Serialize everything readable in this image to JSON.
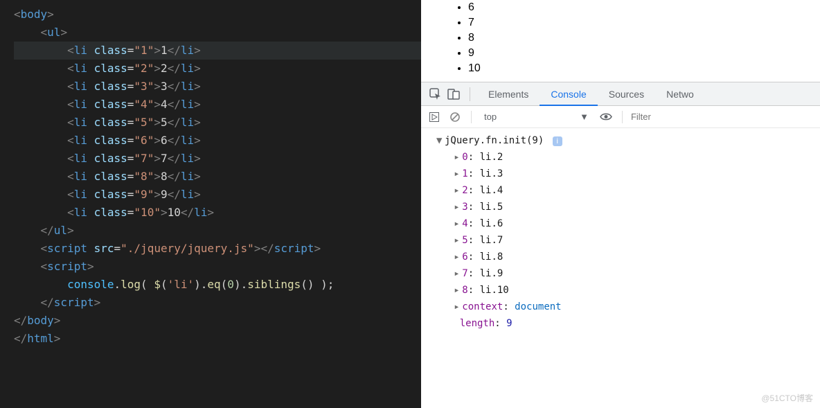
{
  "editor": {
    "lines": [
      {
        "indent": 0,
        "tokens": [
          [
            "punct",
            "<"
          ],
          [
            "tag",
            "body"
          ],
          [
            "punct",
            ">"
          ]
        ]
      },
      {
        "indent": 1,
        "tokens": [
          [
            "punct",
            "<"
          ],
          [
            "tag",
            "ul"
          ],
          [
            "punct",
            ">"
          ]
        ]
      },
      {
        "indent": 2,
        "highlighted": true,
        "tokens": [
          [
            "punct",
            "<"
          ],
          [
            "tag",
            "li"
          ],
          [
            "txt",
            " "
          ],
          [
            "attr",
            "class"
          ],
          [
            "op",
            "="
          ],
          [
            "str",
            "\"1\""
          ],
          [
            "punct",
            ">"
          ],
          [
            "txt",
            "1"
          ],
          [
            "punct",
            "<"
          ],
          [
            "punct",
            "/"
          ],
          [
            "tag",
            "li"
          ],
          [
            "punct",
            ">"
          ]
        ],
        "caret_after": 8
      },
      {
        "indent": 2,
        "tokens": [
          [
            "punct",
            "<"
          ],
          [
            "tag",
            "li"
          ],
          [
            "txt",
            " "
          ],
          [
            "attr",
            "class"
          ],
          [
            "op",
            "="
          ],
          [
            "str",
            "\"2\""
          ],
          [
            "punct",
            ">"
          ],
          [
            "txt",
            "2"
          ],
          [
            "punct",
            "</"
          ],
          [
            "tag",
            "li"
          ],
          [
            "punct",
            ">"
          ]
        ]
      },
      {
        "indent": 2,
        "tokens": [
          [
            "punct",
            "<"
          ],
          [
            "tag",
            "li"
          ],
          [
            "txt",
            " "
          ],
          [
            "attr",
            "class"
          ],
          [
            "op",
            "="
          ],
          [
            "str",
            "\"3\""
          ],
          [
            "punct",
            ">"
          ],
          [
            "txt",
            "3"
          ],
          [
            "punct",
            "</"
          ],
          [
            "tag",
            "li"
          ],
          [
            "punct",
            ">"
          ]
        ]
      },
      {
        "indent": 2,
        "tokens": [
          [
            "punct",
            "<"
          ],
          [
            "tag",
            "li"
          ],
          [
            "txt",
            " "
          ],
          [
            "attr",
            "class"
          ],
          [
            "op",
            "="
          ],
          [
            "str",
            "\"4\""
          ],
          [
            "punct",
            ">"
          ],
          [
            "txt",
            "4"
          ],
          [
            "punct",
            "</"
          ],
          [
            "tag",
            "li"
          ],
          [
            "punct",
            ">"
          ]
        ]
      },
      {
        "indent": 2,
        "tokens": [
          [
            "punct",
            "<"
          ],
          [
            "tag",
            "li"
          ],
          [
            "txt",
            " "
          ],
          [
            "attr",
            "class"
          ],
          [
            "op",
            "="
          ],
          [
            "str",
            "\"5\""
          ],
          [
            "punct",
            ">"
          ],
          [
            "txt",
            "5"
          ],
          [
            "punct",
            "</"
          ],
          [
            "tag",
            "li"
          ],
          [
            "punct",
            ">"
          ]
        ]
      },
      {
        "indent": 2,
        "tokens": [
          [
            "punct",
            "<"
          ],
          [
            "tag",
            "li"
          ],
          [
            "txt",
            " "
          ],
          [
            "attr",
            "class"
          ],
          [
            "op",
            "="
          ],
          [
            "str",
            "\"6\""
          ],
          [
            "punct",
            ">"
          ],
          [
            "txt",
            "6"
          ],
          [
            "punct",
            "</"
          ],
          [
            "tag",
            "li"
          ],
          [
            "punct",
            ">"
          ]
        ]
      },
      {
        "indent": 2,
        "tokens": [
          [
            "punct",
            "<"
          ],
          [
            "tag",
            "li"
          ],
          [
            "txt",
            " "
          ],
          [
            "attr",
            "class"
          ],
          [
            "op",
            "="
          ],
          [
            "str",
            "\"7\""
          ],
          [
            "punct",
            ">"
          ],
          [
            "txt",
            "7"
          ],
          [
            "punct",
            "</"
          ],
          [
            "tag",
            "li"
          ],
          [
            "punct",
            ">"
          ]
        ]
      },
      {
        "indent": 2,
        "tokens": [
          [
            "punct",
            "<"
          ],
          [
            "tag",
            "li"
          ],
          [
            "txt",
            " "
          ],
          [
            "attr",
            "class"
          ],
          [
            "op",
            "="
          ],
          [
            "str",
            "\"8\""
          ],
          [
            "punct",
            ">"
          ],
          [
            "txt",
            "8"
          ],
          [
            "punct",
            "</"
          ],
          [
            "tag",
            "li"
          ],
          [
            "punct",
            ">"
          ]
        ]
      },
      {
        "indent": 2,
        "tokens": [
          [
            "punct",
            "<"
          ],
          [
            "tag",
            "li"
          ],
          [
            "txt",
            " "
          ],
          [
            "attr",
            "class"
          ],
          [
            "op",
            "="
          ],
          [
            "str",
            "\"9\""
          ],
          [
            "punct",
            ">"
          ],
          [
            "txt",
            "9"
          ],
          [
            "punct",
            "</"
          ],
          [
            "tag",
            "li"
          ],
          [
            "punct",
            ">"
          ]
        ]
      },
      {
        "indent": 2,
        "tokens": [
          [
            "punct",
            "<"
          ],
          [
            "tag",
            "li"
          ],
          [
            "txt",
            " "
          ],
          [
            "attr",
            "class"
          ],
          [
            "op",
            "="
          ],
          [
            "str",
            "\"10\""
          ],
          [
            "punct",
            ">"
          ],
          [
            "txt",
            "10"
          ],
          [
            "punct",
            "</"
          ],
          [
            "tag",
            "li"
          ],
          [
            "punct",
            ">"
          ]
        ]
      },
      {
        "indent": 1,
        "tokens": [
          [
            "punct",
            "</"
          ],
          [
            "tag",
            "ul"
          ],
          [
            "punct",
            ">"
          ]
        ]
      },
      {
        "indent": 0,
        "tokens": [
          [
            "txt",
            ""
          ]
        ]
      },
      {
        "indent": 1,
        "tokens": [
          [
            "punct",
            "<"
          ],
          [
            "tag",
            "script"
          ],
          [
            "txt",
            " "
          ],
          [
            "attr",
            "src"
          ],
          [
            "op",
            "="
          ],
          [
            "str",
            "\"./jquery/jquery.js\""
          ],
          [
            "punct",
            ">"
          ],
          [
            "punct",
            "</"
          ],
          [
            "tag",
            "script"
          ],
          [
            "punct",
            ">"
          ]
        ]
      },
      {
        "indent": 1,
        "tokens": [
          [
            "punct",
            "<"
          ],
          [
            "tag",
            "script"
          ],
          [
            "punct",
            ">"
          ]
        ]
      },
      {
        "indent": 2,
        "tokens": [
          [
            "obj",
            "console"
          ],
          [
            "txt",
            "."
          ],
          [
            "fn",
            "log"
          ],
          [
            "txt",
            "( "
          ],
          [
            "fn",
            "$"
          ],
          [
            "txt",
            "("
          ],
          [
            "str",
            "'li'"
          ],
          [
            "txt",
            ")."
          ],
          [
            "fn",
            "eq"
          ],
          [
            "txt",
            "("
          ],
          [
            "num",
            "0"
          ],
          [
            "txt",
            ")."
          ],
          [
            "fn",
            "siblings"
          ],
          [
            "txt",
            "() );"
          ]
        ]
      },
      {
        "indent": 1,
        "tokens": [
          [
            "punct",
            "</"
          ],
          [
            "tag",
            "script"
          ],
          [
            "punct",
            ">"
          ]
        ]
      },
      {
        "indent": 0,
        "tokens": [
          [
            "punct",
            "</"
          ],
          [
            "tag",
            "body"
          ],
          [
            "punct",
            ">"
          ]
        ]
      },
      {
        "indent": 0,
        "tokens": [
          [
            "punct",
            "</"
          ],
          [
            "tag",
            "html"
          ],
          [
            "punct",
            ">"
          ]
        ]
      }
    ]
  },
  "page": {
    "items": [
      "6",
      "7",
      "8",
      "9",
      "10"
    ]
  },
  "devtools": {
    "tabs": [
      "Elements",
      "Console",
      "Sources",
      "Netwo"
    ],
    "active_tab": 1,
    "context": "top",
    "filter_placeholder": "Filter",
    "output": {
      "header": "jQuery.fn.init(9)",
      "items": [
        {
          "k": "0",
          "v": "li.2"
        },
        {
          "k": "1",
          "v": "li.3"
        },
        {
          "k": "2",
          "v": "li.4"
        },
        {
          "k": "3",
          "v": "li.5"
        },
        {
          "k": "4",
          "v": "li.6"
        },
        {
          "k": "5",
          "v": "li.7"
        },
        {
          "k": "6",
          "v": "li.8"
        },
        {
          "k": "7",
          "v": "li.9"
        },
        {
          "k": "8",
          "v": "li.10"
        }
      ],
      "context_label": "context",
      "context_value": "document",
      "length_label": "length",
      "length_value": "9"
    }
  },
  "watermark": "@51CTO博客"
}
